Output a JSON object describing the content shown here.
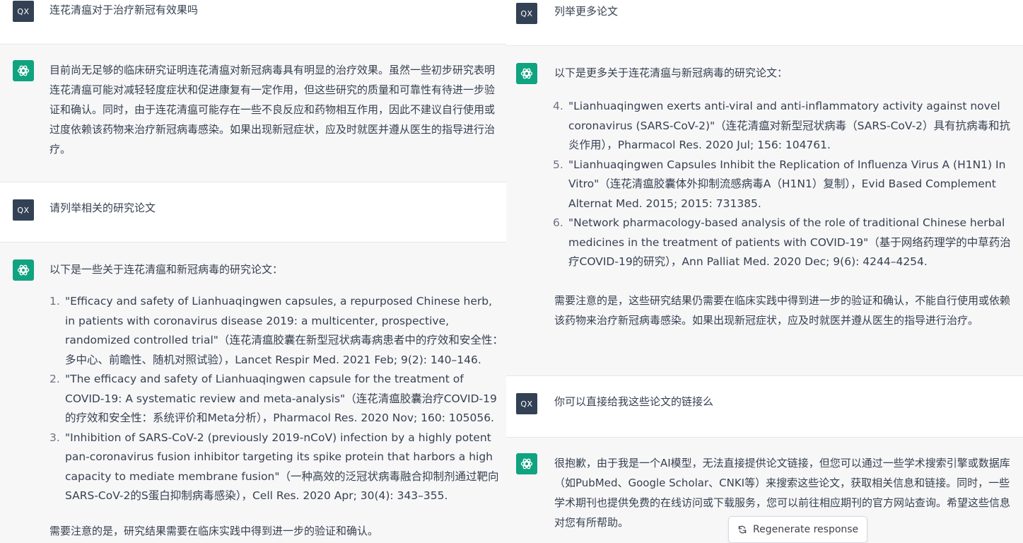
{
  "user_avatar": "QX",
  "left": {
    "q1": "连花清瘟对于治疗新冠有效果吗",
    "a1": "目前尚无足够的临床研究证明连花清瘟对新冠病毒具有明显的治疗效果。虽然一些初步研究表明连花清瘟可能对减轻轻度症状和促进康复有一定作用，但这些研究的质量和可靠性有待进一步验证和确认。同时，由于连花清瘟可能存在一些不良反应和药物相互作用，因此不建议自行使用或过度依赖该药物来治疗新冠病毒感染。如果出现新冠症状，应及时就医并遵从医生的指导进行治疗。",
    "q2": "请列举相关的研究论文",
    "a2_intro": "以下是一些关于连花清瘟和新冠病毒的研究论文：",
    "a2_items": [
      {
        "num": "1.",
        "text": "\"Efficacy and safety of Lianhuaqingwen capsules, a repurposed Chinese herb, in patients with coronavirus disease 2019: a multicenter, prospective, randomized controlled trial\"（连花清瘟胶囊在新型冠状病毒病患者中的疗效和安全性：多中心、前瞻性、随机对照试验），Lancet Respir Med. 2021 Feb; 9(2): 140–146."
      },
      {
        "num": "2.",
        "text": "\"The efficacy and safety of Lianhuaqingwen capsule for the treatment of COVID-19: A systematic review and meta-analysis\"（连花清瘟胶囊治疗COVID-19的疗效和安全性：系统评价和Meta分析），Pharmacol Res. 2020 Nov; 160: 105056."
      },
      {
        "num": "3.",
        "text": "\"Inhibition of SARS-CoV-2 (previously 2019-nCoV) infection by a highly potent pan-coronavirus fusion inhibitor targeting its spike protein that harbors a high capacity to mediate membrane fusion\"（一种高效的泛冠状病毒融合抑制剂通过靶向SARS-CoV-2的S蛋白抑制病毒感染），Cell Res. 2020 Apr; 30(4): 343–355."
      }
    ],
    "a2_note": "需要注意的是，研究结果需要在临床实践中得到进一步的验证和确认。"
  },
  "right": {
    "q3": "列举更多论文",
    "a3_intro": "以下是更多关于连花清瘟与新冠病毒的研究论文：",
    "a3_items": [
      {
        "num": "4.",
        "text": "\"Lianhuaqingwen exerts anti-viral and anti-inflammatory activity against novel coronavirus (SARS-CoV-2)\"（连花清瘟对新型冠状病毒（SARS-CoV-2）具有抗病毒和抗炎作用），Pharmacol Res. 2020 Jul; 156: 104761."
      },
      {
        "num": "5.",
        "text": "\"Lianhuaqingwen Capsules Inhibit the Replication of Influenza Virus A (H1N1) In Vitro\"（连花清瘟胶囊体外抑制流感病毒A（H1N1）复制），Evid Based Complement Alternat Med. 2015; 2015: 731385."
      },
      {
        "num": "6.",
        "text": "\"Network pharmacology-based analysis of the role of traditional Chinese herbal medicines in the treatment of patients with COVID-19\"（基于网络药理学的中草药治疗COVID-19的研究），Ann Palliat Med. 2020 Dec; 9(6): 4244–4254."
      }
    ],
    "a3_note": "需要注意的是，这些研究结果仍需要在临床实践中得到进一步的验证和确认，不能自行使用或依赖该药物来治疗新冠病毒感染。如果出现新冠症状，应及时就医并遵从医生的指导进行治疗。",
    "q4": "你可以直接给我这些论文的链接么",
    "a4": "很抱歉，由于我是一个AI模型，无法直接提供论文链接，但您可以通过一些学术搜索引擎或数据库（如PubMed、Google Scholar、CNKI等）来搜索这些论文，获取相关信息和链接。同时，一些学术期刊也提供免费的在线访问或下载服务，您可以前往相应期刊的官方网站查询。希望这些信息对您有所帮助。",
    "regenerate_label": "Regenerate response"
  },
  "colors": {
    "user_avatar_bg": "#334155",
    "bot_avatar_bg": "#10a37f",
    "bot_bg": "#f7f7f8"
  },
  "icons": {
    "bot_avatar": "openai-logo-icon",
    "regenerate": "refresh-icon"
  }
}
